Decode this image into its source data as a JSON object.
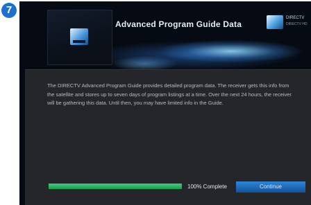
{
  "step": "7",
  "header": {
    "title": "Advanced Program Guide Data",
    "brand_line1": "DIRECTV",
    "brand_line2": "DIRECTV HD"
  },
  "message": "The DIRECTV Advanced Program Guide provides detailed program data. The receiver gets this info from the satellite and stores up to seven days of program listings at a time. Over the next 24 hours, the receiver will be gathering this data. Until then, you may have limited info in the Guide.",
  "progress": {
    "label": "100% Complete",
    "fraction": 1.0
  },
  "continue_label": "Continue",
  "colors": {
    "accent": "#1d6fd0",
    "progress": "#2fb865",
    "button": "#1f6fc0"
  }
}
